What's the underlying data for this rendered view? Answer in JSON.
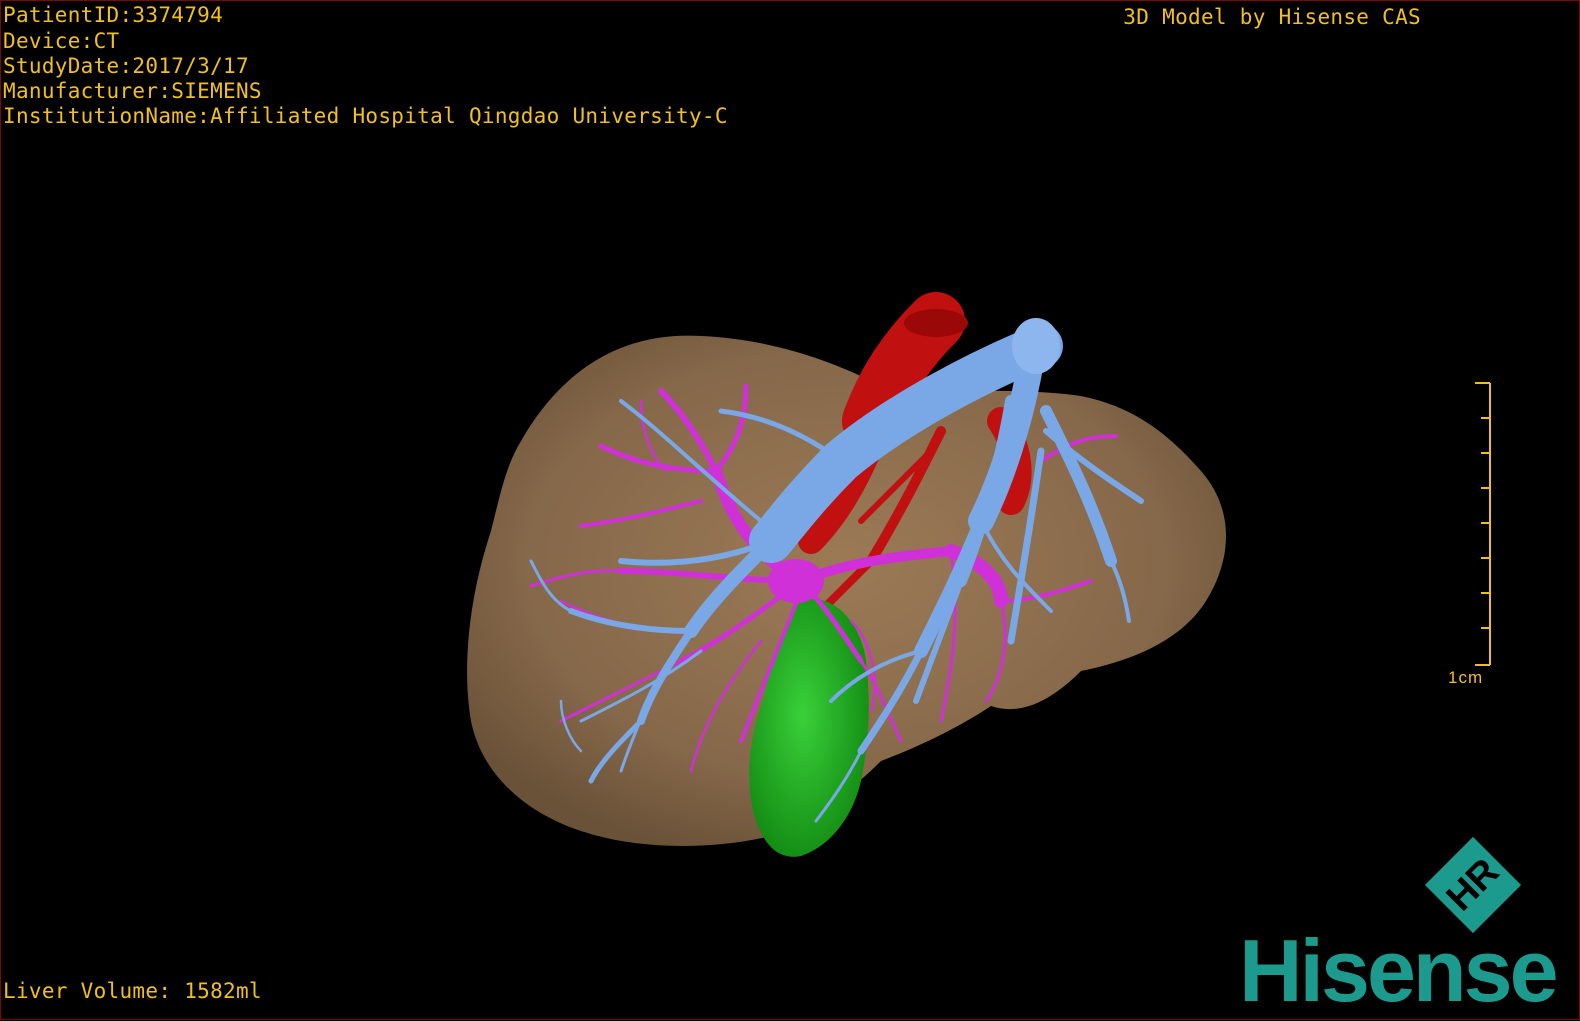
{
  "overlay": {
    "patient_id": "PatientID:3374794",
    "device": "Device:CT",
    "study_date": "StudyDate:2017/3/17",
    "manufacturer": "Manufacturer:SIEMENS",
    "institution": "InstitutionName:Affiliated Hospital Qingdao University-C",
    "title": "3D Model by Hisense CAS",
    "liver_volume": "Liver Volume: 1582ml"
  },
  "scale_bar": {
    "label": "1cm"
  },
  "brand": {
    "name": "Hisense",
    "badge": "HR",
    "color": "#1c9a8e"
  },
  "colors": {
    "text": "#f0c020",
    "liver": "#8a6b48",
    "portal_vein": "#7aa8e6",
    "hepatic_vein": "#d030d8",
    "artery": "#c01010",
    "gallbladder": "#22b022"
  }
}
